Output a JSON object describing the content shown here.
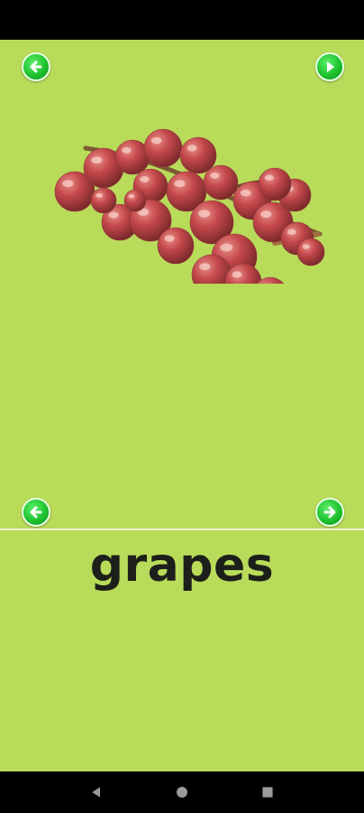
{
  "card": {
    "word": "grapes",
    "image_icon": "grapes-illustration"
  },
  "buttons": {
    "top_left_icon": "arrow-left-icon",
    "top_right_icon": "play-icon",
    "bottom_left_icon": "arrow-left-icon",
    "bottom_right_icon": "arrow-right-icon"
  },
  "system_nav": {
    "back_icon": "back-triangle-icon",
    "home_icon": "home-circle-icon",
    "recents_icon": "recents-square-icon"
  },
  "colors": {
    "background": "#b9db5a",
    "button_green": "#1ec22f",
    "word_text": "#1c1f1a",
    "grape": "#c4484b"
  }
}
